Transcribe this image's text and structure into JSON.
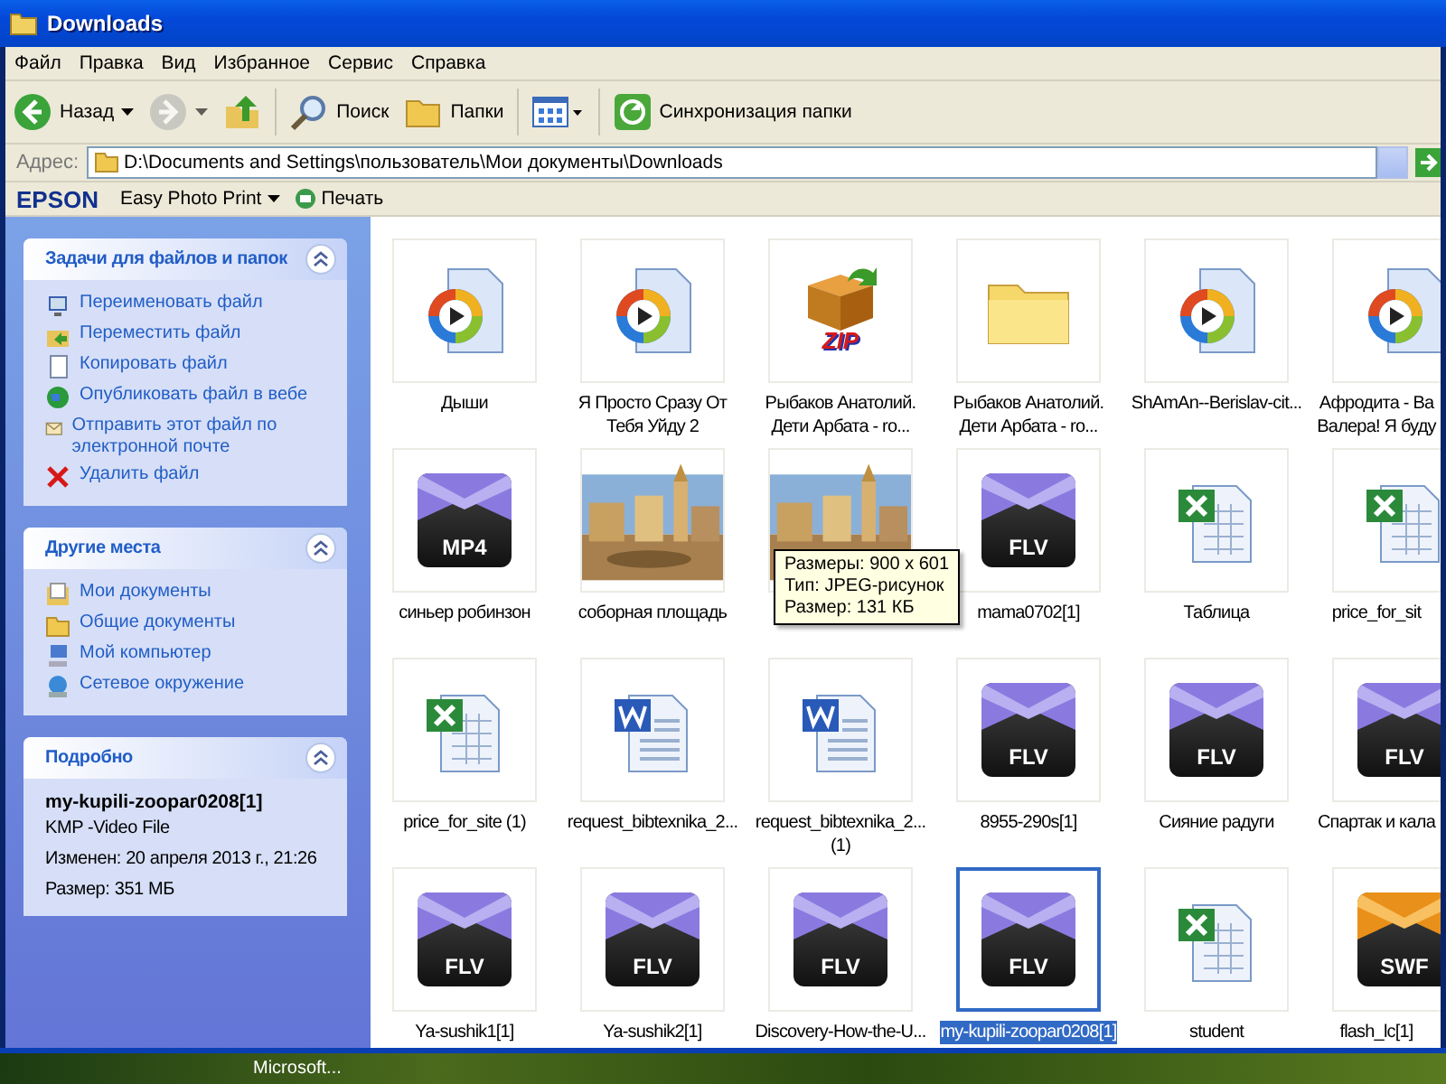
{
  "window": {
    "title": "Downloads"
  },
  "menu": [
    "Файл",
    "Правка",
    "Вид",
    "Избранное",
    "Сервис",
    "Справка"
  ],
  "toolbar": [
    {
      "kind": "back",
      "label": "Назад",
      "disabled": false
    },
    {
      "kind": "forward",
      "disabled": true
    },
    {
      "kind": "up",
      "disabled": false
    },
    {
      "kind": "search",
      "label": "Поиск",
      "disabled": false
    },
    {
      "kind": "folders",
      "label": "Папки",
      "disabled": false
    },
    {
      "kind": "views",
      "disabled": false
    },
    {
      "kind": "sync",
      "label": "Синхронизация папки",
      "disabled": false
    }
  ],
  "address": {
    "label": "Адрес:",
    "value": "D:\\Documents and Settings\\пользователь\\Мои документы\\Downloads"
  },
  "epson": {
    "brand": "EPSON",
    "menu": "Easy Photo Print",
    "print": "Печать"
  },
  "panels": [
    {
      "kind": "links",
      "title": "Задачи для файлов и папок",
      "items": [
        {
          "kind": "rename",
          "label": "Переименовать файл"
        },
        {
          "kind": "move",
          "label": "Переместить файл"
        },
        {
          "kind": "copy",
          "label": "Копировать файл"
        },
        {
          "kind": "web",
          "label": "Опубликовать файл в вебе"
        },
        {
          "kind": "mail",
          "label": "Отправить этот файл по электронной почте"
        },
        {
          "kind": "delete",
          "label": "Удалить файл"
        }
      ]
    },
    {
      "kind": "links",
      "title": "Другие места",
      "items": [
        {
          "kind": "docs",
          "label": "Мои документы"
        },
        {
          "kind": "folder",
          "label": "Общие документы"
        },
        {
          "kind": "computer",
          "label": "Мой компьютер"
        },
        {
          "kind": "network",
          "label": "Сетевое окружение"
        }
      ]
    },
    {
      "kind": "details",
      "title": "Подробно",
      "name": "my-kupili-zoopar0208[1]",
      "type": "KMP -Video File",
      "modified": "Изменен: 20 апреля 2013 г., 21:26",
      "size": "Размер: 351 МБ"
    }
  ],
  "files": [
    {
      "kind": "media",
      "lines": [
        "Дыши"
      ],
      "selected": false
    },
    {
      "kind": "media",
      "lines": [
        "Я Просто Сразу От",
        "Тебя Уйду 2"
      ],
      "selected": false
    },
    {
      "kind": "zip",
      "badge": "ZIP",
      "lines": [
        "Рыбаков Анатолий.",
        "Дети Арбата - ro..."
      ],
      "selected": false
    },
    {
      "kind": "folder",
      "lines": [
        "Рыбаков Анатолий.",
        "Дети Арбата - ro..."
      ],
      "selected": false
    },
    {
      "kind": "media",
      "lines": [
        "ShAmAn--Berislav-cit..."
      ],
      "selected": false
    },
    {
      "kind": "media",
      "lines": [
        "Афродита - Ва",
        "Валера! Я буду"
      ],
      "selected": false
    },
    {
      "kind": "video",
      "badge": "MP4",
      "lines": [
        "синьер робинзон"
      ],
      "selected": false
    },
    {
      "kind": "picture",
      "lines": [
        "соборная площадь"
      ],
      "selected": false
    },
    {
      "kind": "picture",
      "selected": false,
      "tooltip": [
        "Размеры: 900 x 601",
        "Тип: JPEG-рисунок",
        "Размер: 131 КБ"
      ]
    },
    {
      "kind": "video",
      "badge": "FLV",
      "lines": [
        "mama0702[1]"
      ],
      "selected": false
    },
    {
      "kind": "sheet",
      "lines": [
        "Таблица"
      ],
      "selected": false
    },
    {
      "kind": "sheet",
      "lines": [
        "price_for_sit"
      ],
      "selected": false
    },
    {
      "kind": "sheet",
      "lines": [
        "price_for_site (1)"
      ],
      "selected": false
    },
    {
      "kind": "doc",
      "lines": [
        "request_bibtexnika_2..."
      ],
      "selected": false
    },
    {
      "kind": "doc",
      "lines": [
        "request_bibtexnika_2...",
        "(1)"
      ],
      "selected": false
    },
    {
      "kind": "video",
      "badge": "FLV",
      "lines": [
        "8955-290s[1]"
      ],
      "selected": false
    },
    {
      "kind": "video",
      "badge": "FLV",
      "lines": [
        "Сияние радуги"
      ],
      "selected": false
    },
    {
      "kind": "video",
      "badge": "FLV",
      "lines": [
        "Спартак и кала"
      ],
      "selected": false
    },
    {
      "kind": "video",
      "badge": "FLV",
      "lines": [
        "Ya-sushik1[1]"
      ],
      "selected": false
    },
    {
      "kind": "video",
      "badge": "FLV",
      "lines": [
        "Ya-sushik2[1]"
      ],
      "selected": false
    },
    {
      "kind": "video",
      "badge": "FLV",
      "lines": [
        "Discovery-How-the-U..."
      ],
      "selected": false
    },
    {
      "kind": "video",
      "badge": "FLV",
      "lines": [
        "my-kupili-zoopar0208[1]"
      ],
      "selected": true
    },
    {
      "kind": "sheet",
      "lines": [
        "student"
      ],
      "selected": false
    },
    {
      "kind": "flash",
      "badge": "SWF",
      "lines": [
        "flash_lc[1]"
      ],
      "selected": false
    }
  ],
  "desktop": {
    "label": "Microsoft..."
  }
}
